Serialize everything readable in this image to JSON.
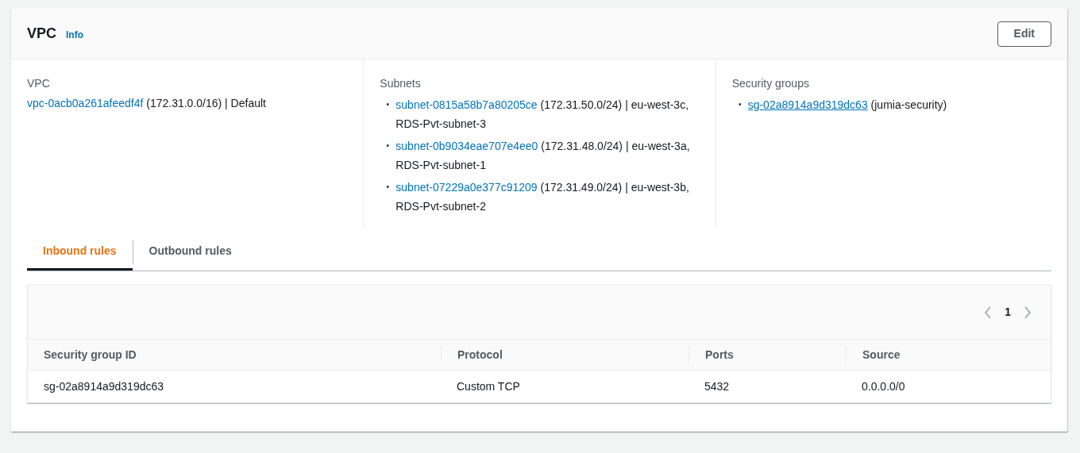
{
  "panel": {
    "title": "VPC",
    "info": "Info",
    "edit_button": "Edit"
  },
  "vpc": {
    "label": "VPC",
    "link": "vpc-0acb0a261afeedf4f",
    "text": "(172.31.0.0/16) | Default"
  },
  "subnets": {
    "label": "Subnets",
    "items": [
      {
        "bullet": "•",
        "link": "subnet-0815a58b7a80205ce",
        "text": "(172.31.50.0/24) | eu-west-3c, RDS-Pvt-subnet-3"
      },
      {
        "bullet": "•",
        "link": "subnet-0b9034eae707e4ee0",
        "text": "(172.31.48.0/24) | eu-west-3a, RDS-Pvt-subnet-1"
      },
      {
        "bullet": "•",
        "link": "subnet-07229a0e377c91209",
        "text": "(172.31.49.0/24) | eu-west-3b, RDS-Pvt-subnet-2"
      }
    ]
  },
  "security_groups": {
    "label": "Security groups",
    "items": [
      {
        "bullet": "•",
        "link": "sg-02a8914a9d319dc63",
        "text": "(jumia-security)"
      }
    ]
  },
  "tabs": [
    {
      "label": "Inbound rules",
      "selected": true
    },
    {
      "label": "Outbound rules",
      "selected": false
    }
  ],
  "pagination": {
    "page": "1"
  },
  "table": {
    "columns": [
      "Security group ID",
      "Protocol",
      "Ports",
      "Source"
    ],
    "rows": [
      [
        "sg-02a8914a9d319dc63",
        "Custom TCP",
        "5432",
        "0.0.0.0/0"
      ]
    ]
  }
}
